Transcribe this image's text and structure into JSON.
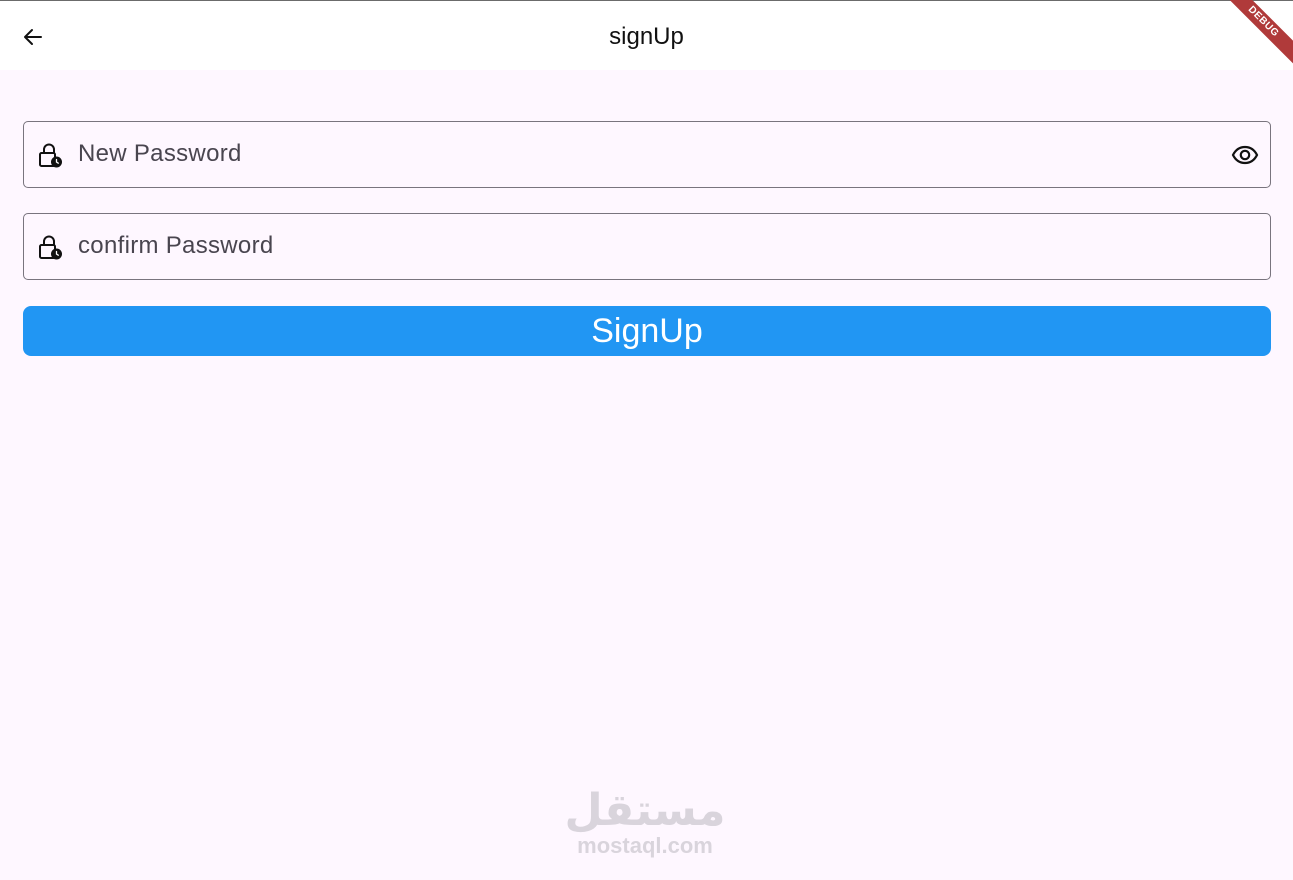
{
  "app_bar": {
    "title": "signUp",
    "back_icon": "arrow-back-icon",
    "debug_banner": "DEBUG"
  },
  "form": {
    "new_password": {
      "placeholder": "New Password",
      "value": "",
      "prefix_icon": "lock-clock-icon",
      "suffix_icon": "eye-icon"
    },
    "confirm_password": {
      "placeholder": "confirm Password",
      "value": "",
      "prefix_icon": "lock-clock-icon"
    },
    "submit_label": "SignUp"
  },
  "watermark": {
    "arabic": "مستقل",
    "latin": "mostaql.com"
  },
  "colors": {
    "background": "#fef7ff",
    "app_bar": "#ffffff",
    "primary_button": "#2196f3",
    "field_border": "#79747e",
    "debug_ribbon": "#b03a3a"
  }
}
